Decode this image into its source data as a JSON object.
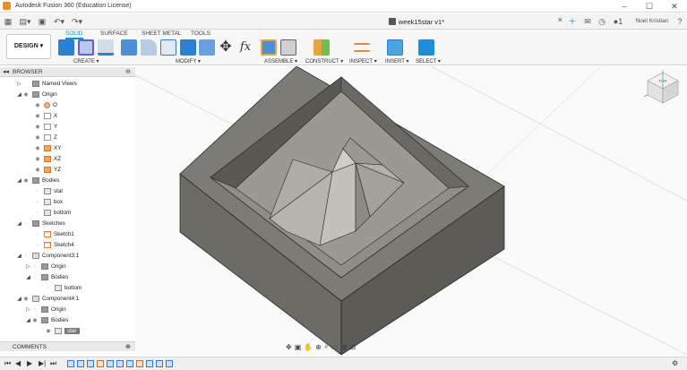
{
  "window": {
    "title": "Autodesk Fusion 360 (Education License)",
    "controls": [
      "minimize-icon",
      "maximize-icon",
      "close-icon"
    ]
  },
  "document": {
    "tab_label": "week15star v1*",
    "close_label": "×"
  },
  "user": {
    "name": "Noel Kristian",
    "job_count": "1"
  },
  "workspace": {
    "label": "DESIGN ▾"
  },
  "ribbon": {
    "tabs": [
      "SOLID",
      "SURFACE",
      "SHEET METAL",
      "TOOLS"
    ],
    "active_tab": "SOLID",
    "groups": [
      "CREATE ▾",
      "MODIFY ▾",
      "ASSEMBLE ▾",
      "CONSTRUCT ▾",
      "INSPECT ▾",
      "INSERT ▾",
      "SELECT ▾"
    ]
  },
  "browser": {
    "title": "BROWSER",
    "nodes": [
      {
        "label": "Named Views"
      },
      {
        "label": "Origin"
      },
      {
        "label": "O"
      },
      {
        "label": "X"
      },
      {
        "label": "Y"
      },
      {
        "label": "Z"
      },
      {
        "label": "XY"
      },
      {
        "label": "XZ"
      },
      {
        "label": "YZ"
      },
      {
        "label": "Bodies"
      },
      {
        "label": "star"
      },
      {
        "label": "box"
      },
      {
        "label": "bottom"
      },
      {
        "label": "Sketches"
      },
      {
        "label": "Sketch1"
      },
      {
        "label": "Sketch4"
      },
      {
        "label": "Component3:1"
      },
      {
        "label": "Origin"
      },
      {
        "label": "Bodies"
      },
      {
        "label": "bottom"
      },
      {
        "label": "Component4:1"
      },
      {
        "label": "Origin"
      },
      {
        "label": "Bodies"
      },
      {
        "label": "star"
      }
    ]
  },
  "comments": {
    "title": "COMMENTS"
  },
  "viewcube": {
    "label": "TOP"
  },
  "colors": {
    "accent": "#0696d7",
    "body_dark": "#5f5d58",
    "body_mid": "#7c7a74",
    "floor": "#8d8b85"
  }
}
